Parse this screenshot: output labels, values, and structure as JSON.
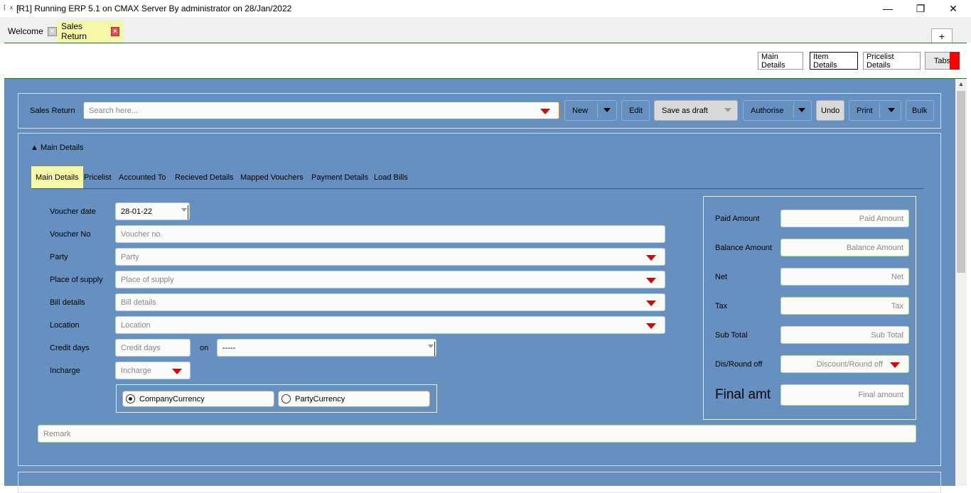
{
  "window": {
    "icon": "[ x ]",
    "title": "[R1] Running ERP 5.1 on CMAX Server By administrator on 28/Jan/2022",
    "minimize": "—",
    "maximize": "❐",
    "close": "✕"
  },
  "doc_tabs": [
    {
      "label": "Welcome",
      "close": "×"
    },
    {
      "label": "Sales Return",
      "close": "×"
    }
  ],
  "plus_tab": "+",
  "header_buttons": {
    "main_details": "Main Details",
    "item_details": "Item Details",
    "pricelist_details": "Pricelist Details",
    "tabs": "Tabs"
  },
  "toolbar": {
    "label": "Sales Return",
    "search_placeholder": "Search here...",
    "new": "New",
    "edit": "Edit",
    "save_as_draft": "Save as draft",
    "authorise": "Authorise",
    "undo": "Undo",
    "print": "Print",
    "bulk": "Bulk"
  },
  "section": {
    "toggle": "▲ Main Details"
  },
  "subtabs": [
    "Main Details",
    "Pricelist",
    "Accounted To",
    "Recieved Details",
    "Mapped Vouchers",
    "Payment Details",
    "Load Bills"
  ],
  "form": {
    "voucher_date": {
      "label": "Voucher date",
      "value": "28-01-22"
    },
    "voucher_no": {
      "label": "Voucher No",
      "placeholder": "Voucher no."
    },
    "party": {
      "label": "Party",
      "placeholder": "Party"
    },
    "place_of_supply": {
      "label": "Place of supply",
      "placeholder": "Place of supply"
    },
    "bill_details": {
      "label": "Bill details",
      "placeholder": "Bill details"
    },
    "location": {
      "label": "Location",
      "placeholder": "Location"
    },
    "credit_days": {
      "label": "Credit days",
      "placeholder": "Credit days",
      "on_label": "on",
      "on_value": "-----"
    },
    "incharge": {
      "label": "Incharge",
      "placeholder": "Incharge"
    },
    "currency": {
      "company": "CompanyCurrency",
      "party": "PartyCurrency",
      "selected": "company"
    },
    "remark": {
      "placeholder": "Remark"
    }
  },
  "totals": {
    "paid_amount": {
      "label": "Paid Amount",
      "placeholder": "Paid Amount"
    },
    "balance_amount": {
      "label": "Balance Amount",
      "placeholder": "Balance Amount"
    },
    "net": {
      "label": "Net",
      "placeholder": "Net"
    },
    "tax": {
      "label": "Tax",
      "placeholder": "Tax"
    },
    "sub_total": {
      "label": "Sub Total",
      "placeholder": "Sub Total"
    },
    "dis_round_off": {
      "label": "Dis/Round off",
      "placeholder": "Discount/Round off"
    },
    "final_amt": {
      "label": "Final amt",
      "placeholder": "Final amount"
    }
  }
}
